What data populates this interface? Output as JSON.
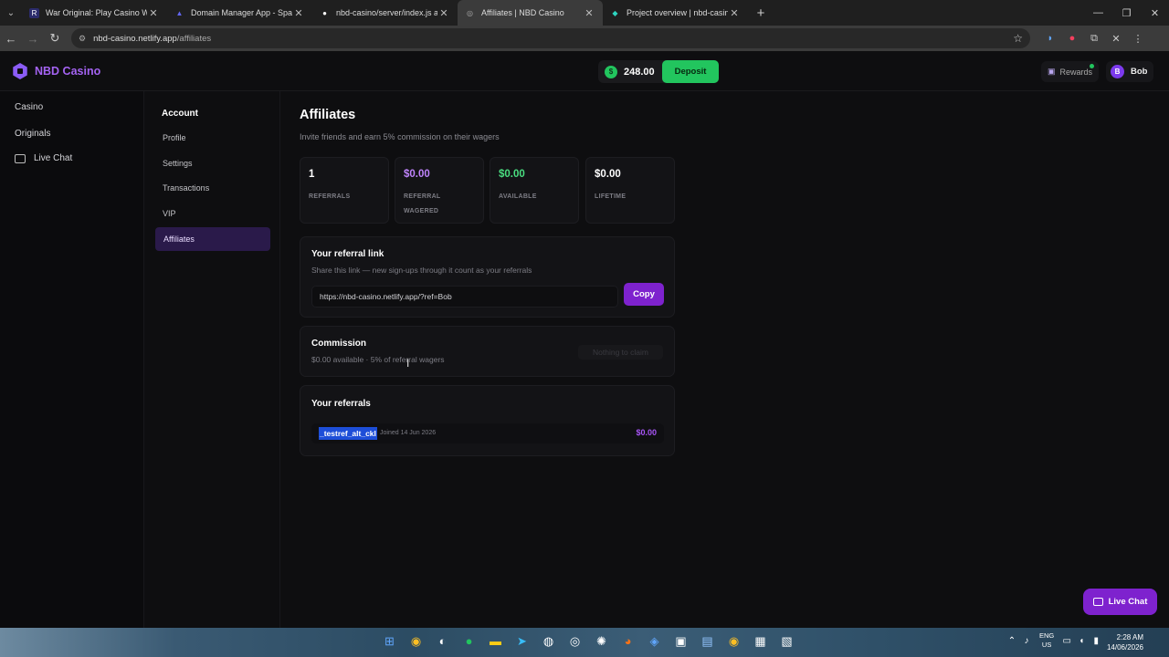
{
  "browser": {
    "tabs": [
      {
        "label": "War Original: Play Casino War C",
        "fav": "R",
        "fav_color": "#2b2b6b"
      },
      {
        "label": "Domain Manager App - Spacesh",
        "fav": "▲",
        "fav_color": "#4f46e5"
      },
      {
        "label": "nbd-casino/server/index.js at m",
        "fav": "●",
        "fav_color": "#ffffff"
      },
      {
        "label": "Affiliates | NBD Casino",
        "fav": "◎",
        "fav_color": "#999999",
        "active": true
      },
      {
        "label": "Project overview | nbd-casino |",
        "fav": "◆",
        "fav_color": "#2dd4bf"
      }
    ],
    "url_host": "nbd-casino.netlify.app",
    "url_path": "/affiliates"
  },
  "brand": {
    "name": "NBD Casino",
    "color": "#a463f2"
  },
  "header": {
    "balance": "248.00",
    "coin_symbol": "$",
    "deposit_label": "Deposit",
    "rewards_label": "Rewards",
    "user_initial": "B",
    "user_name": "Bob"
  },
  "sidebar": {
    "items": [
      {
        "label": "Casino"
      },
      {
        "label": "Originals"
      },
      {
        "label": "Live Chat"
      }
    ]
  },
  "account_nav": {
    "heading": "Account",
    "items": [
      {
        "label": "Profile"
      },
      {
        "label": "Settings"
      },
      {
        "label": "Transactions"
      },
      {
        "label": "VIP"
      },
      {
        "label": "Affiliates",
        "active": true
      }
    ]
  },
  "page": {
    "title": "Affiliates",
    "subtitle": "Invite friends and earn 5% commission on their wagers"
  },
  "stats": [
    {
      "value": "1",
      "label": "Referrals",
      "color": "#ffffff"
    },
    {
      "value": "$0.00",
      "label": "Referral Wagered",
      "color": "#c084fc"
    },
    {
      "value": "$0.00",
      "label": "Available",
      "color": "#4ade80"
    },
    {
      "value": "$0.00",
      "label": "Lifetime",
      "color": "#ffffff"
    }
  ],
  "referral_link": {
    "title": "Your referral link",
    "description": "Share this link — new sign-ups through it count as your referrals",
    "url": "https://nbd-casino.netlify.app/?ref=Bob",
    "copy_label": "Copy"
  },
  "commission": {
    "title": "Commission",
    "description": "$0.00 available · 5% of referral wagers",
    "claim_label": "Nothing to claim"
  },
  "referrals": {
    "title": "Your referrals",
    "rows": [
      {
        "name": "_testref_alt_ckl",
        "joined": "Joined 14 Jun 2026",
        "amount": "$0.00"
      }
    ]
  },
  "live_chat_button": "Live Chat",
  "taskbar": {
    "lang_line1": "ENG",
    "lang_line2": "US",
    "time": "2:28 AM",
    "date": "14/06/2026"
  }
}
